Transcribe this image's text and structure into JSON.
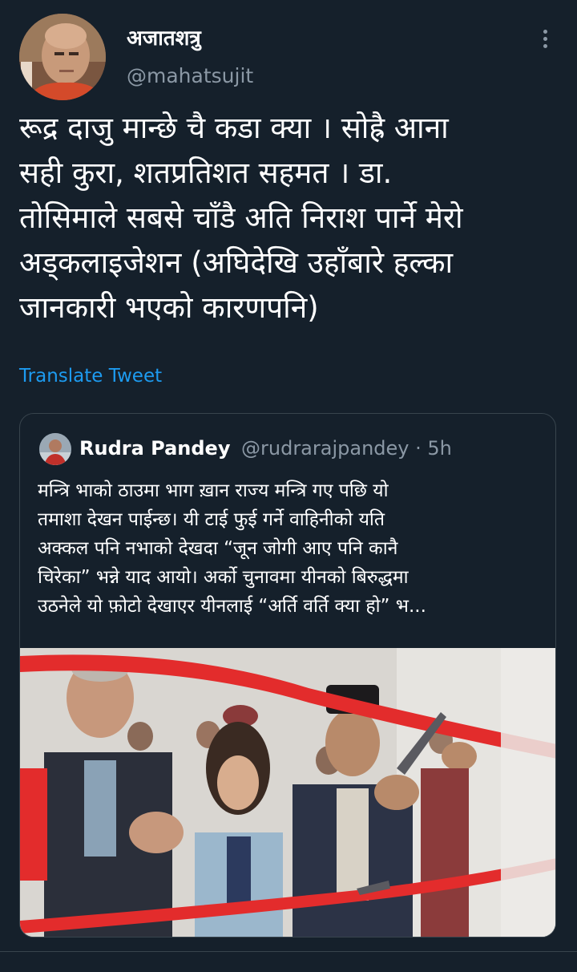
{
  "author": {
    "display_name": "अजातशत्रु",
    "handle": "@mahatsujit"
  },
  "tweet": {
    "text": "रूद्र दाजु मान्छे चै कडा क्या । सोह्रै आना\nसही कुरा, शतप्रतिशत सहमत । डा.\nतोसिमाले सबसे चाँडै अति निराश पार्ने मेरो\nअड्कलाइजेशन (अघिदेखि उहाँबारे हल्का\nजानकारी भएको कारणपनि)",
    "translate_label": "Translate Tweet"
  },
  "quoted": {
    "display_name": "Rudra Pandey",
    "meta": "@rudrarajpandey · 5h",
    "text": "मन्त्रि भाको ठाउमा भाग ख़ान राज्य मन्त्रि गए पछि यो\nतमाशा देखन पाईन्छ। यी टाई फुई गर्ने वाहिनीको यति\nअक्कल पनि नभाको देखदा “जून जोगी आए पनि कानै\nचिरेका” भन्ने याद आयो। अर्को चुनावमा यीनको बिरुद्धमा\nउठनेले यो फ़ोटो देखाएर यीनलाई “अर्ति वर्ति क्या हो” भ...",
    "photo_icon": "ribbon-cutting-photo"
  },
  "icons": {
    "more": "vertical-ellipsis-icon"
  },
  "colors": {
    "background": "#15202b",
    "accent": "#1d9bf0",
    "secondary_text": "#8b98a5",
    "border": "#38444d"
  }
}
